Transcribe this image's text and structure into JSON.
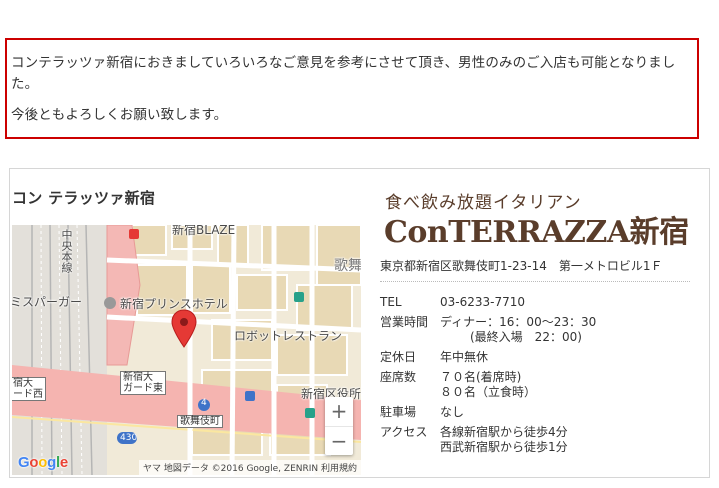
{
  "notice": {
    "line1": "コンテラッツァ新宿におきましていろいろなご意見を参考にさせて頂き、男性のみのご入店も可能となりました。",
    "line2": "今後ともよろしくお願い致します。"
  },
  "map": {
    "title": "コン テラッツァ新宿",
    "labels": {
      "hotel": "新宿プリンスホテル",
      "robot": "ロボットレストラン",
      "blaze": "新宿BLAZE",
      "kabuki": "歌舞",
      "super": "ミスパーガー",
      "chuo": "中央本線",
      "ward": "新宿区役所",
      "kabukicho": "歌舞伎町",
      "gard": "新宿大\nガード東",
      "gard_w": "宿大\nード西",
      "route430": "430",
      "route4": "4"
    },
    "zoom_in": "+",
    "zoom_out": "−",
    "attribution": "ヤマ 地図データ ©2016 Google, ZENRIN   利用規約",
    "google": [
      "G",
      "o",
      "o",
      "g",
      "l",
      "e"
    ],
    "google_colors": [
      "#4285f4",
      "#ea4335",
      "#fbbc05",
      "#4285f4",
      "#34a853",
      "#ea4335"
    ]
  },
  "shop": {
    "tagline": "食べ飲み放題イタリアン",
    "name": "ConTERRAZZA新宿",
    "address": "東京都新宿区歌舞伎町1-23-14　第一メトロビル1Ｆ",
    "details": [
      {
        "key": "TEL",
        "value": [
          "03-6233-7710"
        ]
      },
      {
        "key": "営業時間",
        "value": [
          "ディナー：16：00〜23：30",
          "(最終入場　22：00)"
        ]
      },
      {
        "key": "定休日",
        "value": [
          "年中無休"
        ]
      },
      {
        "key": "座席数",
        "value": [
          "７０名(着席時)",
          "８０名（立食時）"
        ]
      },
      {
        "key": "駐車場",
        "value": [
          "なし"
        ]
      },
      {
        "key": "アクセス",
        "value": [
          "各線新宿駅から徒歩4分",
          "西武新宿駅から徒歩1分"
        ]
      }
    ]
  },
  "colors": {
    "notice_border": "#cc0000",
    "brand": "#5a3d2b",
    "pin": "#e53935"
  }
}
